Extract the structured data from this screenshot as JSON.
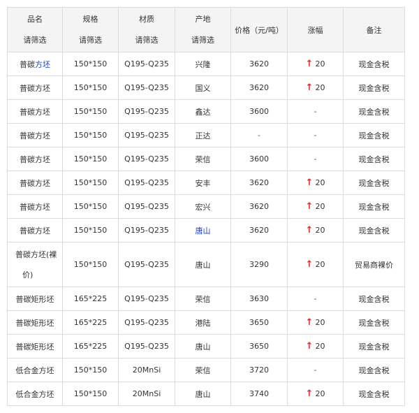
{
  "colors": {
    "accent_up": "#e02a2a",
    "link_blue": "#1a3fd8"
  },
  "header": {
    "name": {
      "label": "品名",
      "filter": "请筛选"
    },
    "spec": {
      "label": "规格",
      "filter": "请筛选"
    },
    "material": {
      "label": "材质",
      "filter": "请筛选"
    },
    "origin": {
      "label": "产地",
      "filter": "请筛选"
    },
    "price": "价格（元/吨）",
    "change": "涨幅",
    "note": "备注"
  },
  "rows": [
    {
      "name_a": "普碳",
      "name_b": "方坯",
      "spec": "150*150",
      "material": "Q195-Q235",
      "origin": "兴隆",
      "price": "3620",
      "change": "20",
      "up": true,
      "note": "现金含税"
    },
    {
      "name": "普碳方坯",
      "spec": "150*150",
      "material": "Q195-Q235",
      "origin": "国义",
      "price": "3620",
      "change": "20",
      "up": true,
      "note": "现金含税"
    },
    {
      "name": "普碳方坯",
      "spec": "150*150",
      "material": "Q195-Q235",
      "origin": "鑫达",
      "price": "3600",
      "change": "-",
      "up": false,
      "note": "现金含税"
    },
    {
      "name": "普碳方坯",
      "spec": "150*150",
      "material": "Q195-Q235",
      "origin": "正达",
      "price": "-",
      "change": "-",
      "up": false,
      "note": "现金含税"
    },
    {
      "name": "普碳方坯",
      "spec": "150*150",
      "material": "Q195-Q235",
      "origin": "荣信",
      "price": "3600",
      "change": "-",
      "up": false,
      "note": "现金含税"
    },
    {
      "name": "普碳方坯",
      "spec": "150*150",
      "material": "Q195-Q235",
      "origin": "安丰",
      "price": "3620",
      "change": "20",
      "up": true,
      "note": "现金含税"
    },
    {
      "name": "普碳方坯",
      "spec": "150*150",
      "material": "Q195-Q235",
      "origin": "宏兴",
      "price": "3620",
      "change": "20",
      "up": true,
      "note": "现金含税"
    },
    {
      "name": "普碳方坯",
      "spec": "150*150",
      "material": "Q195-Q235",
      "origin": "唐山",
      "price": "3620",
      "change": "20",
      "up": true,
      "note": "现金含税"
    },
    {
      "name_line1": "普碳方坯(裸",
      "name_line2": "价)",
      "spec": "150*150",
      "material": "Q195-Q235",
      "origin": "唐山",
      "price": "3290",
      "change": "20",
      "up": true,
      "note": "贸易商裸价"
    },
    {
      "name": "普碳矩形坯",
      "spec": "165*225",
      "material": "Q195-Q235",
      "origin": "荣信",
      "price": "3630",
      "change": "-",
      "up": false,
      "note": "现金含税"
    },
    {
      "name": "普碳矩形坯",
      "spec": "165*225",
      "material": "Q195-Q235",
      "origin": "港陆",
      "price": "3650",
      "change": "20",
      "up": true,
      "note": "现金含税"
    },
    {
      "name": "普碳矩形坯",
      "spec": "165*225",
      "material": "Q195-Q235",
      "origin": "唐山",
      "price": "3650",
      "change": "20",
      "up": true,
      "note": "现金含税"
    },
    {
      "name": "低合金方坯",
      "spec": "150*150",
      "material": "20MnSi",
      "origin": "荣信",
      "price": "3720",
      "change": "-",
      "up": false,
      "note": "现金含税"
    },
    {
      "name": "低合金方坯",
      "spec": "150*150",
      "material": "20MnSi",
      "origin": "唐山",
      "price": "3740",
      "change": "20",
      "up": true,
      "note": "现金含税"
    }
  ]
}
